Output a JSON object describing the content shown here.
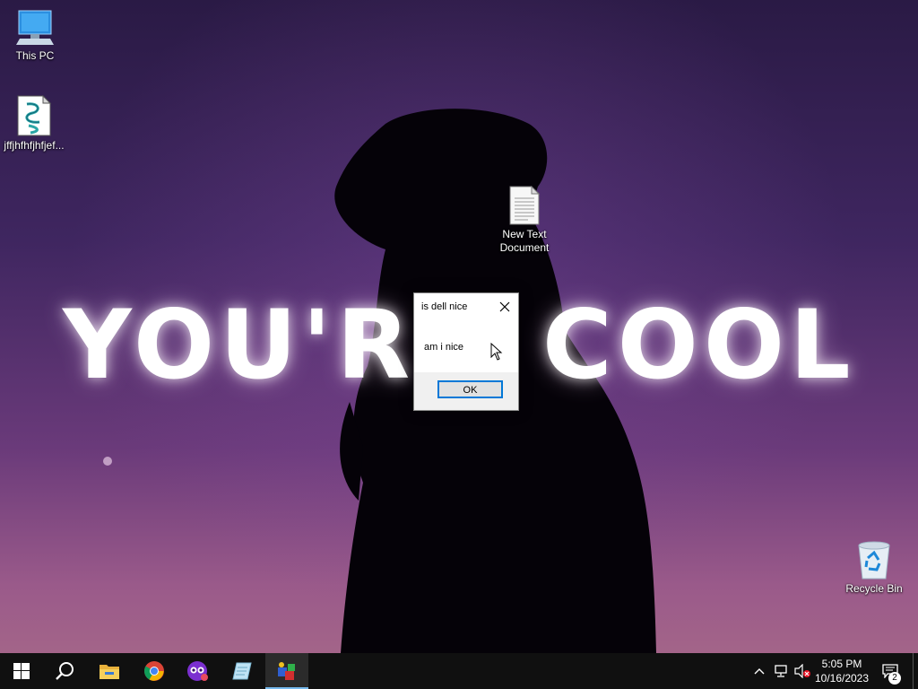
{
  "desktop": {
    "wallpaper_text_left": "YOU'R",
    "wallpaper_text_right": "COOL",
    "icons": [
      {
        "label": "This PC",
        "icon": "this-pc-icon"
      },
      {
        "label": "jffjhfhfjhfjef...",
        "icon": "script-file-icon"
      },
      {
        "label": "New Text Document",
        "icon": "text-document-icon"
      },
      {
        "label": "Recycle Bin",
        "icon": "recycle-bin-icon"
      }
    ]
  },
  "dialog": {
    "title": "is dell nice",
    "message": "am i nice",
    "ok_label": "OK",
    "close_icon": "close-icon"
  },
  "taskbar": {
    "apps": [
      {
        "name": "start",
        "icon": "windows-logo-icon"
      },
      {
        "name": "search",
        "icon": "search-icon"
      },
      {
        "name": "file-explorer",
        "icon": "folder-icon"
      },
      {
        "name": "chrome",
        "icon": "chrome-icon"
      },
      {
        "name": "app-purple",
        "icon": "purple-app-icon"
      },
      {
        "name": "app-notepad",
        "icon": "notepad-icon"
      },
      {
        "name": "app-active",
        "icon": "colorful-app-icon",
        "active": true
      }
    ],
    "tray": {
      "chevron": "chevron-up-icon",
      "network": "network-icon",
      "volume": "volume-muted-icon"
    },
    "clock": {
      "time": "5:05 PM",
      "date": "10/16/2023"
    },
    "notifications": {
      "count": "2",
      "icon": "action-center-icon"
    }
  },
  "colors": {
    "accent": "#0078d7",
    "taskbar": "#101010",
    "active_underline": "#76b9ed"
  }
}
